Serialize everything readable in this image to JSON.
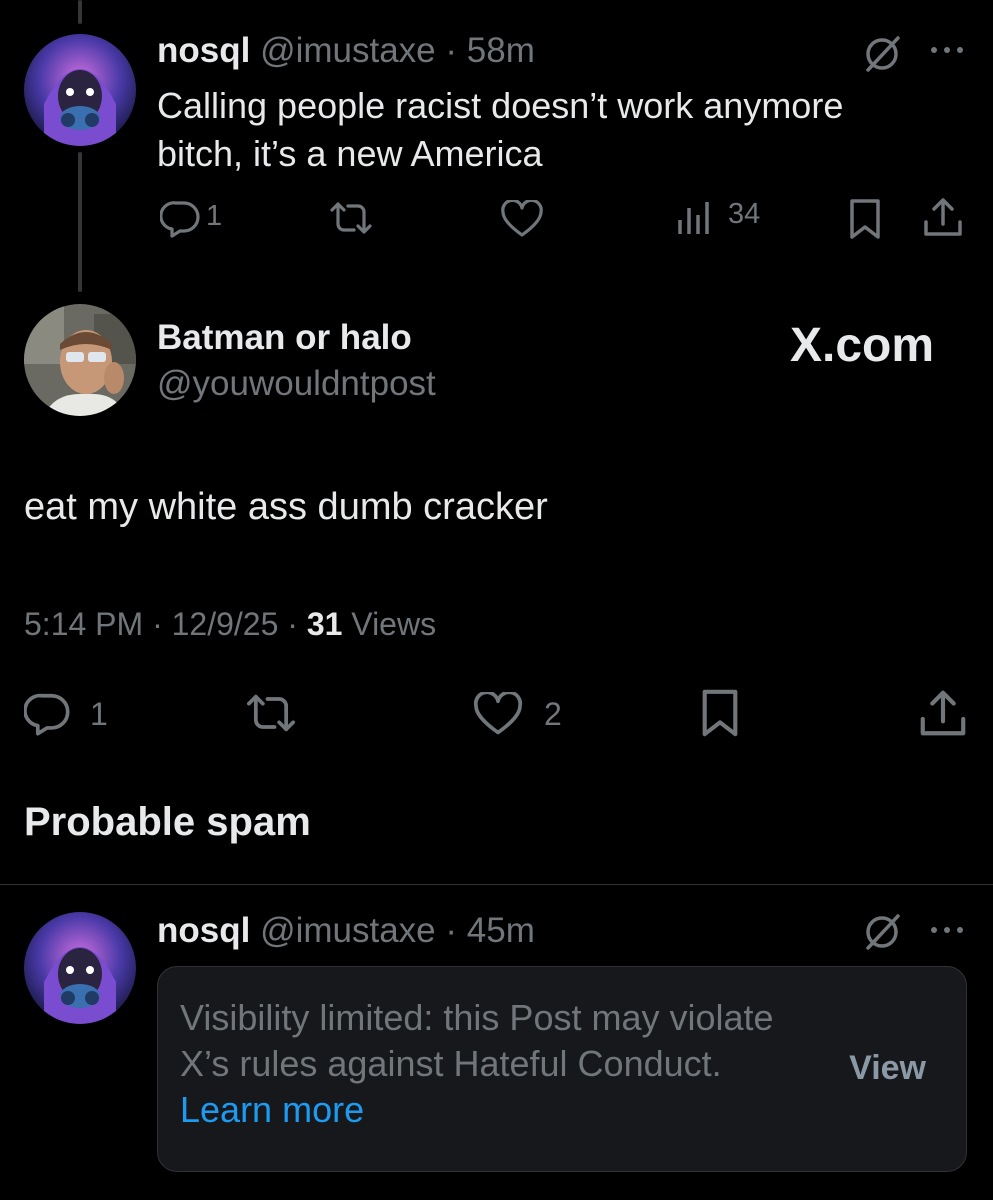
{
  "post1": {
    "name": "nosql",
    "handle": "@imustaxe",
    "time": "58m",
    "text_line1": "Calling people racist doesn’t work anymore",
    "text_line2": "bitch, it’s a new America",
    "replies": "1",
    "views": "34"
  },
  "post2": {
    "name": "Batman or halo",
    "handle": "@youwouldntpost",
    "source_label": "X.com",
    "text": "eat my white ass dumb cracker",
    "time": "5:14 PM",
    "date": "12/9/25",
    "views_count": "31",
    "views_label": "Views",
    "replies": "1",
    "likes": "2"
  },
  "spam_header": "Probable spam",
  "post3": {
    "name": "nosql",
    "handle": "@imustaxe",
    "time": "45m",
    "notice_text": "Visibility limited: this Post may violate X’s rules against Hateful Conduct.",
    "notice_link": "Learn more",
    "view_button": "View"
  },
  "colors": {
    "background": "#000000",
    "text": "#e7e9ea",
    "muted": "#71767b",
    "link": "#1d9bf0"
  },
  "icons": [
    "grok-slash-icon",
    "more-icon",
    "reply-icon",
    "retweet-icon",
    "like-icon",
    "views-icon",
    "bookmark-icon",
    "share-icon"
  ]
}
